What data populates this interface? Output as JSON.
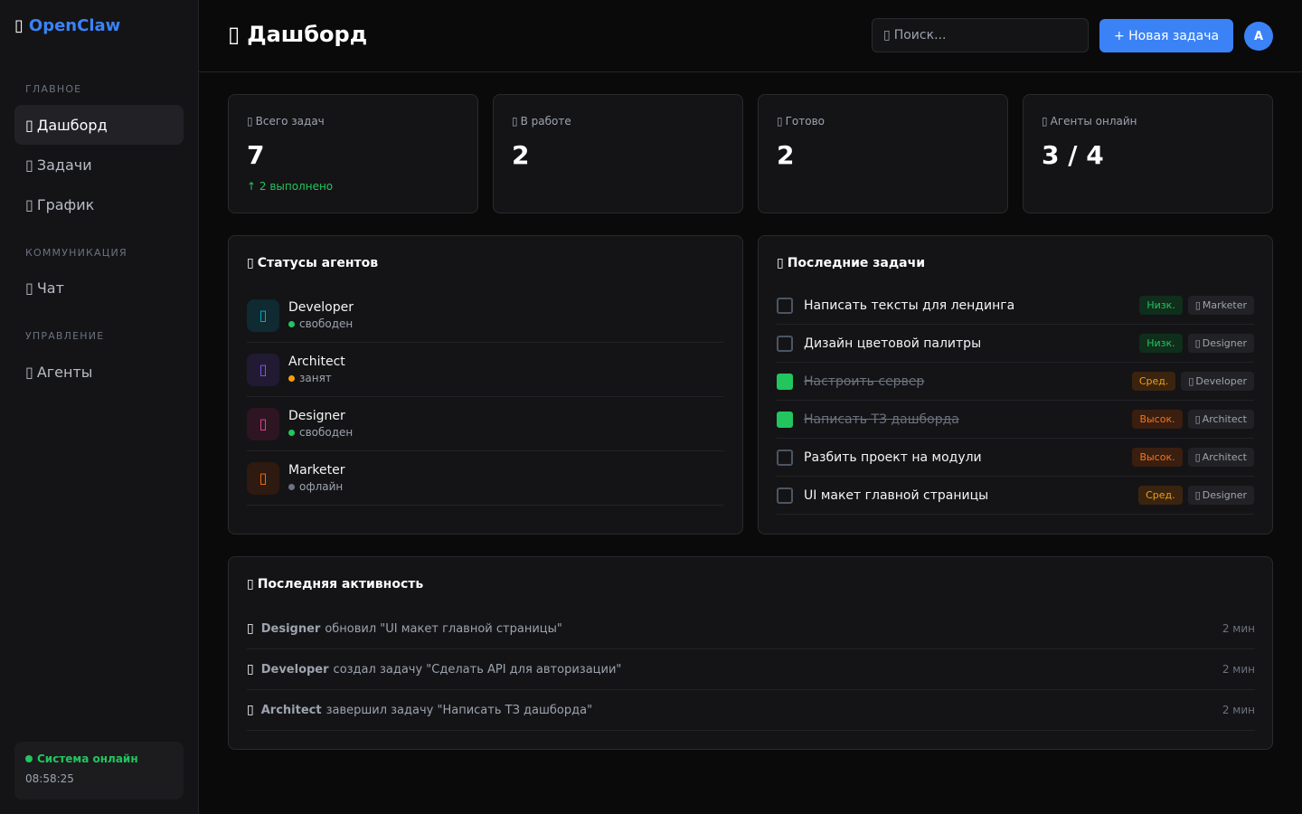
{
  "sidebar": {
    "logo_icon": "▯",
    "logo": "OpenClaw",
    "sections": [
      "ГЛАВНОЕ",
      "КОММУНИКАЦИЯ",
      "УПРАВЛЕНИЕ"
    ],
    "items": [
      {
        "icon": "▯",
        "label": "Дашборд"
      },
      {
        "icon": "▯",
        "label": "Задачи"
      },
      {
        "icon": "▯",
        "label": "График"
      },
      {
        "icon": "▯",
        "label": "Чат"
      },
      {
        "icon": "▯",
        "label": "Агенты"
      }
    ],
    "status": {
      "label": "Система онлайн",
      "time": "08:58:25"
    }
  },
  "header": {
    "title_icon": "▯",
    "title": "Дашборд",
    "search_placeholder": "Поиск...",
    "search_icon": "▯",
    "new_task": "+ Новая задача",
    "avatar": "A"
  },
  "stats": [
    {
      "icon": "▯",
      "label": "Всего задач",
      "value": "7",
      "sub": "↑ 2 выполнено"
    },
    {
      "icon": "▯",
      "label": "В работе",
      "value": "2"
    },
    {
      "icon": "▯",
      "label": "Готово",
      "value": "2"
    },
    {
      "icon": "▯",
      "label": "Агенты онлайн",
      "value": "3 / 4"
    }
  ],
  "agents_panel": {
    "icon": "▯",
    "title": "Статусы агентов",
    "agents": [
      {
        "name": "Developer",
        "status": "свободен",
        "icon": "▯",
        "color": "#22c55e",
        "icon_color": "#06b6d4",
        "bg": "#0f2a30"
      },
      {
        "name": "Architect",
        "status": "занят",
        "icon": "▯",
        "color": "#f59e0b",
        "icon_color": "#8b5cf6",
        "bg": "#221a33"
      },
      {
        "name": "Designer",
        "status": "свободен",
        "icon": "▯",
        "color": "#22c55e",
        "icon_color": "#ec4899",
        "bg": "#2e1522"
      },
      {
        "name": "Marketer",
        "status": "офлайн",
        "icon": "▯",
        "color": "#6b7280",
        "icon_color": "#f97316",
        "bg": "#2e1a10"
      }
    ]
  },
  "tasks_panel": {
    "icon": "▯",
    "title": "Последние задачи",
    "tasks": [
      {
        "title": "Написать тексты для лендинга",
        "done": false,
        "priority": "Низк.",
        "level": "low",
        "assignee": "Marketer"
      },
      {
        "title": "Дизайн цветовой палитры",
        "done": false,
        "priority": "Низк.",
        "level": "low",
        "assignee": "Designer"
      },
      {
        "title": "Настроить сервер",
        "done": true,
        "priority": "Сред.",
        "level": "mid",
        "assignee": "Developer"
      },
      {
        "title": "Написать ТЗ дашборда",
        "done": true,
        "priority": "Высок.",
        "level": "high",
        "assignee": "Architect"
      },
      {
        "title": "Разбить проект на модули",
        "done": false,
        "priority": "Высок.",
        "level": "high",
        "assignee": "Architect"
      },
      {
        "title": "UI макет главной страницы",
        "done": false,
        "priority": "Сред.",
        "level": "mid",
        "assignee": "Designer"
      }
    ],
    "assignee_icon": "▯"
  },
  "activity": {
    "icon": "▯",
    "title": "Последняя активность",
    "items": [
      {
        "icon": "▯",
        "who": "Designer",
        "what": "обновил \"UI макет главной страницы\"",
        "time": "2 мин"
      },
      {
        "icon": "▯",
        "who": "Developer",
        "what": "создал задачу \"Сделать API для авторизации\"",
        "time": "2 мин"
      },
      {
        "icon": "▯",
        "who": "Architect",
        "what": "завершил задачу \"Написать ТЗ дашборда\"",
        "time": "2 мин"
      }
    ]
  }
}
